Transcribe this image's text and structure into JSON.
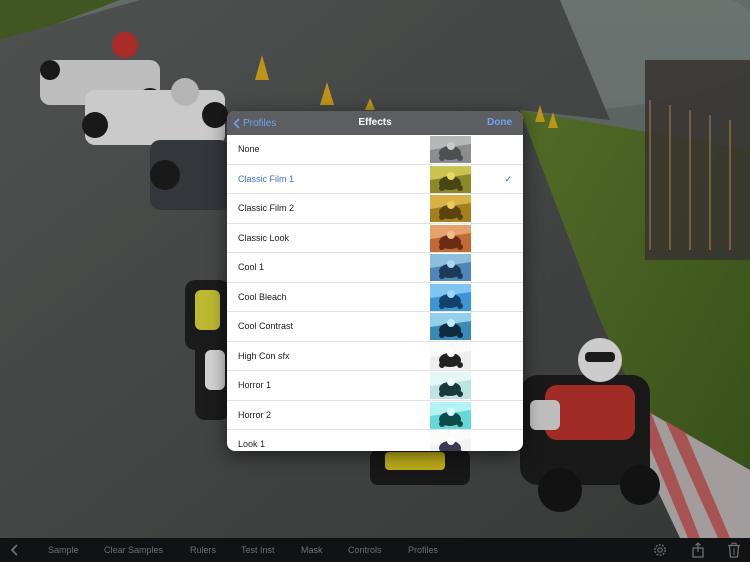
{
  "popover": {
    "back_label": "Profiles",
    "title": "Effects",
    "done_label": "Done",
    "items": [
      {
        "label": "None",
        "selected": false,
        "thumb": [
          "#8a8c8e",
          "#c9c9c9",
          "#4d4f52"
        ]
      },
      {
        "label": "Classic Film 1",
        "selected": true,
        "thumb": [
          "#8a8a2a",
          "#e4db62",
          "#4a4416"
        ]
      },
      {
        "label": "Classic Film 2",
        "selected": false,
        "thumb": [
          "#a47f1c",
          "#efc85a",
          "#5a430e"
        ]
      },
      {
        "label": "Classic Look",
        "selected": false,
        "thumb": [
          "#c26a36",
          "#f4bb86",
          "#6a2a14"
        ]
      },
      {
        "label": "Cool 1",
        "selected": false,
        "thumb": [
          "#4f86b5",
          "#a8d6f0",
          "#1d3a5a"
        ]
      },
      {
        "label": "Cool Bleach",
        "selected": false,
        "thumb": [
          "#3f95d4",
          "#9bd8ff",
          "#14416a"
        ]
      },
      {
        "label": "Cool Contrast",
        "selected": false,
        "thumb": [
          "#3a8ab4",
          "#b9ecff",
          "#0d2c40"
        ]
      },
      {
        "label": "High Con sfx",
        "selected": false,
        "thumb": [
          "#eeeeee",
          "#ffffff",
          "#222222"
        ]
      },
      {
        "label": "Horror 1",
        "selected": false,
        "thumb": [
          "#bfe3e3",
          "#f2ffff",
          "#1a3a3a"
        ]
      },
      {
        "label": "Horror 2",
        "selected": false,
        "thumb": [
          "#67d8d6",
          "#d4ffff",
          "#0f4a4a"
        ]
      },
      {
        "label": "Look 1",
        "selected": false,
        "thumb": [
          "#f2f2f6",
          "#ffffff",
          "#3a3a55"
        ]
      }
    ],
    "check_glyph": "✓"
  },
  "toolbar": {
    "items": [
      "Sample",
      "Clear Samples",
      "Rulers",
      "Test Inst",
      "Mask",
      "Controls",
      "Profiles"
    ],
    "icons": [
      "chevron-left-icon",
      "gear-icon",
      "share-icon",
      "trash-icon"
    ]
  },
  "colors": {
    "accent": "#3a72c6",
    "nav_bar": "#5d5e62",
    "toolbar": "#111214"
  }
}
